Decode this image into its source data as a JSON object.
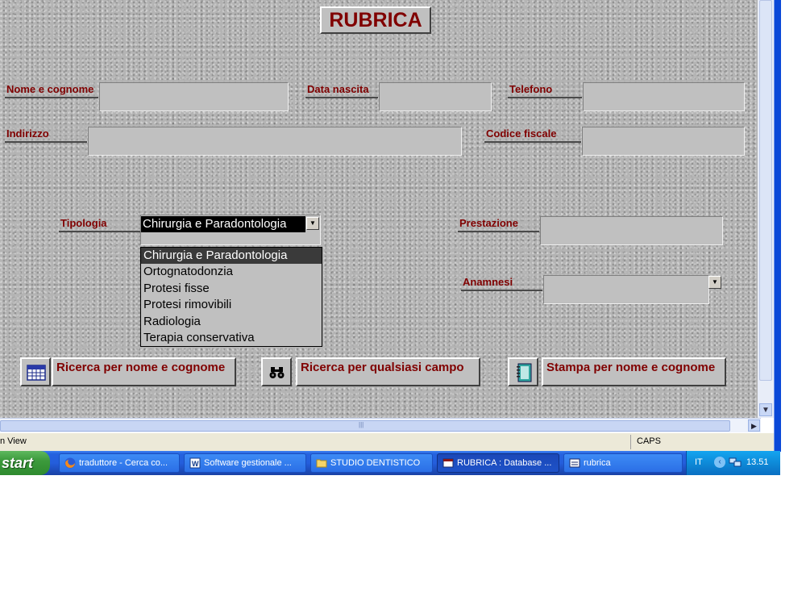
{
  "form": {
    "title": "RUBRICA",
    "labels": {
      "nome": "Nome e cognome",
      "data_nascita": "Data nascita",
      "telefono": "Telefono",
      "indirizzo": "Indirizzo",
      "codice_fiscale": "Codice fiscale",
      "tipologia": "Tipologia",
      "prestazione": "Prestazione",
      "anamnesi": "Anamnesi"
    },
    "tipologia_value": "Chirurgia e Paradontologia",
    "tipologia_options": [
      "Chirurgia e Paradontologia",
      "Ortognatodonzia",
      "Protesi fisse",
      "Protesi rimovibili",
      "Radiologia",
      "Terapia conservativa"
    ],
    "buttons": {
      "ricerca_nome": "Ricerca per nome e cognome",
      "ricerca_campo": "Ricerca per qualsiasi campo",
      "stampa": "Stampa per nome e cognome"
    }
  },
  "statusbar": {
    "view": "n View",
    "caps": "CAPS"
  },
  "taskbar": {
    "start": "start",
    "items": [
      {
        "label": "traduttore - Cerca co...",
        "icon": "firefox-icon"
      },
      {
        "label": "Software gestionale ...",
        "icon": "word-document-icon"
      },
      {
        "label": "STUDIO DENTISTICO",
        "icon": "folder-icon"
      },
      {
        "label": "RUBRICA : Database ...",
        "icon": "access-database-icon",
        "active": true
      },
      {
        "label": "rubrica",
        "icon": "form-icon"
      }
    ],
    "language": "IT",
    "clock": "13.51"
  },
  "colors": {
    "label_text": "#800000",
    "form_background": "#b4b4b4",
    "taskbar_blue": "#245edc",
    "start_green": "#3c9a3c"
  }
}
